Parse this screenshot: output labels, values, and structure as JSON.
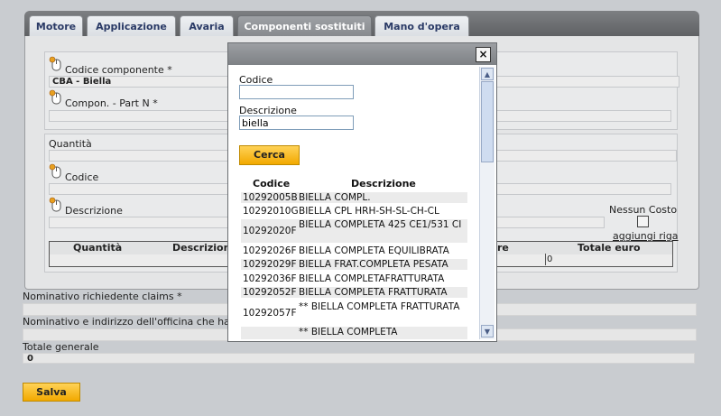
{
  "tabs": [
    {
      "label": "Motore"
    },
    {
      "label": "Applicazione"
    },
    {
      "label": "Avaria"
    },
    {
      "label": "Componenti sostituiti"
    },
    {
      "label": "Mano d'opera"
    }
  ],
  "form": {
    "codice_componente_label": "Codice componente *",
    "codice_componente_value": "CBA - Biella",
    "compon_part_label": "Compon. - Part N *",
    "quantita_label": "Quantità",
    "codice_label": "Codice",
    "descrizione_label": "Descrizione",
    "nessun_costo_label": "Nessun Costo",
    "aggiungi_riga_label": "aggiungi riga"
  },
  "grid": {
    "col_quantita": "Quantità",
    "col_descrizione": "Descrizion",
    "col_re": "re",
    "col_totale": "Totale euro",
    "row_value": "0"
  },
  "footer": {
    "nominativo_label": "Nominativo richiedente claims *",
    "officina_label": "Nominativo e indirizzo dell'officina che ha c",
    "totale_label": "Totale generale",
    "totale_value": "0",
    "salva_label": "Salva"
  },
  "modal": {
    "close_label": "×",
    "codice_label": "Codice",
    "codice_value": "",
    "descrizione_label": "Descrizione",
    "descrizione_value": "biella",
    "cerca_label": "Cerca",
    "col_codice": "Codice",
    "col_descrizione": "Descrizione",
    "results": [
      {
        "codice": "10292005B",
        "descrizione": "BIELLA COMPL."
      },
      {
        "codice": "10292010G",
        "descrizione": "BIELLA CPL HRH-SH-SL-CH-CL"
      },
      {
        "codice": "10292020F",
        "descrizione": "BIELLA COMPLETA 425 CE1/531 CI"
      },
      {
        "codice": "10292026F",
        "descrizione": "BIELLA COMPLETA EQUILIBRATA"
      },
      {
        "codice": "10292029F",
        "descrizione": "BIELLA FRAT.COMPLETA PESATA"
      },
      {
        "codice": "10292036F",
        "descrizione": "BIELLA COMPLETAFRATTURATA"
      },
      {
        "codice": "10292052F",
        "descrizione": "BIELLA COMPLETA FRATTURATA"
      },
      {
        "codice": "10292057F",
        "descrizione": "** BIELLA COMPLETA FRATTURATA"
      },
      {
        "codice": "",
        "descrizione": "** BIELLA COMPLETA"
      }
    ]
  },
  "colors": {
    "accent_button": "#f2a900",
    "tab_text": "#2a3a66",
    "tab_bar": "#6e7074"
  }
}
